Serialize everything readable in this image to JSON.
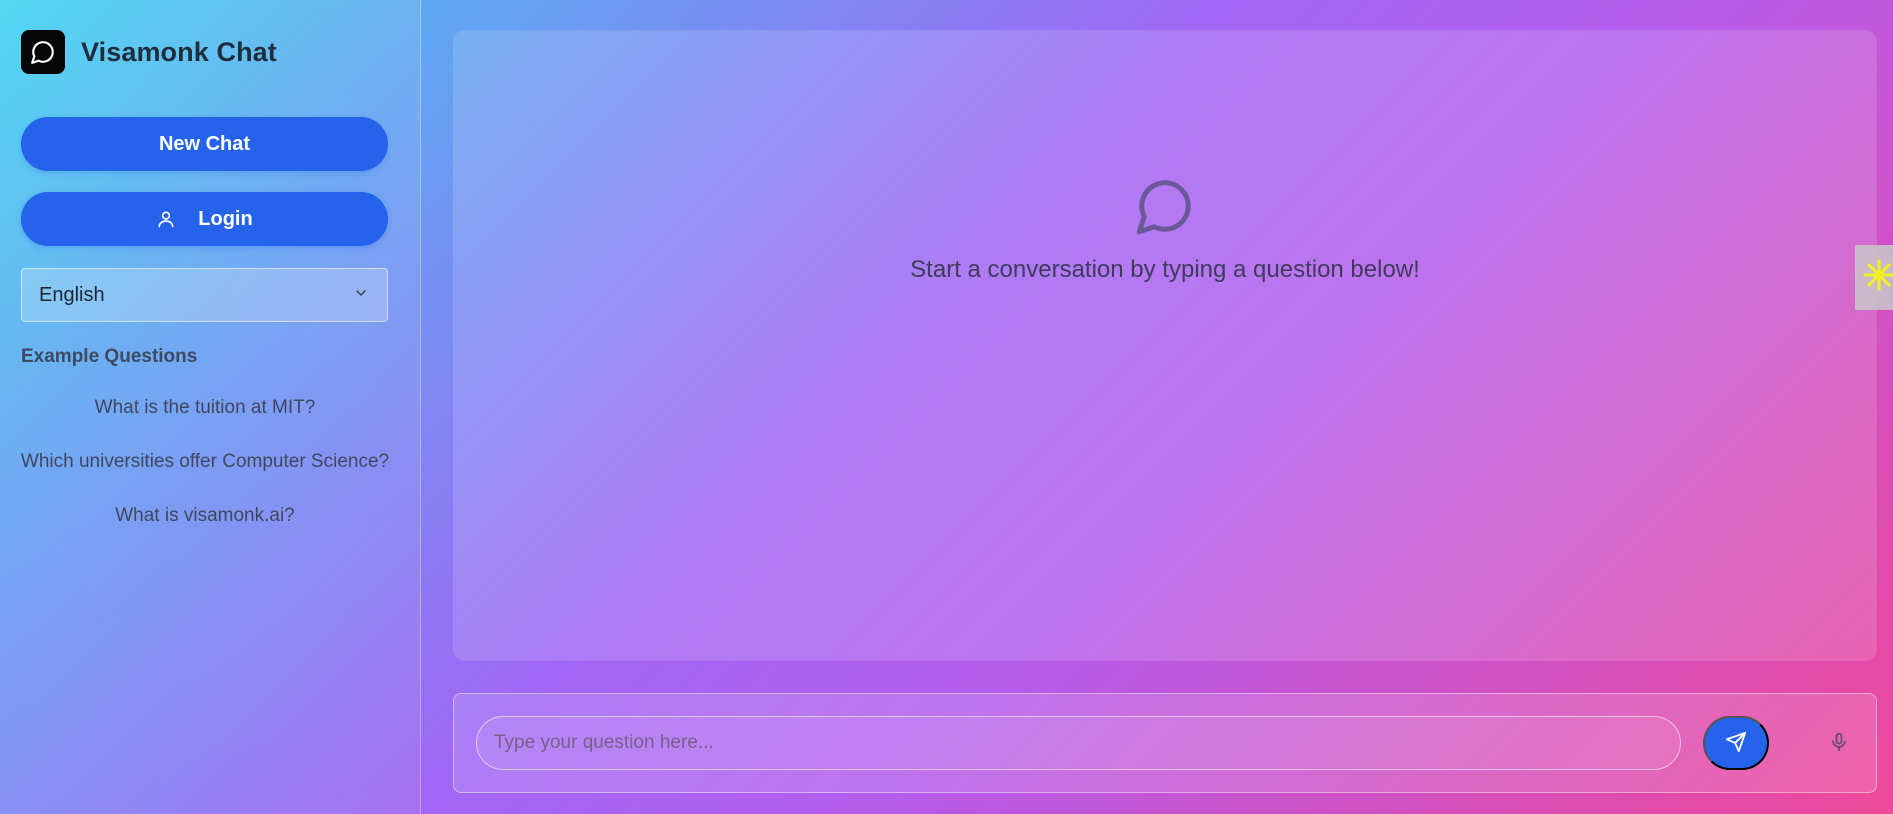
{
  "app": {
    "title": "Visamonk Chat",
    "logo_icon": "chat-bubble-icon"
  },
  "sidebar": {
    "new_chat_label": "New Chat",
    "login_label": "Login",
    "login_icon": "user-icon",
    "language": {
      "selected": "English",
      "icon": "chevron-down-icon"
    },
    "examples_heading": "Example Questions",
    "examples": [
      "What is the tuition at MIT?",
      "Which universities offer Computer Science?",
      "What is visamonk.ai?"
    ]
  },
  "chat": {
    "empty_icon": "chat-bubble-icon",
    "empty_text": "Start a conversation by typing a question below!"
  },
  "input": {
    "placeholder": "Type your question here...",
    "value": "",
    "send_icon": "send-icon",
    "mic_icon": "microphone-icon"
  },
  "side_tab": {
    "icon": "sparkle-icon"
  },
  "colors": {
    "primary": "#2563eb",
    "title": "#1f2d3d"
  }
}
